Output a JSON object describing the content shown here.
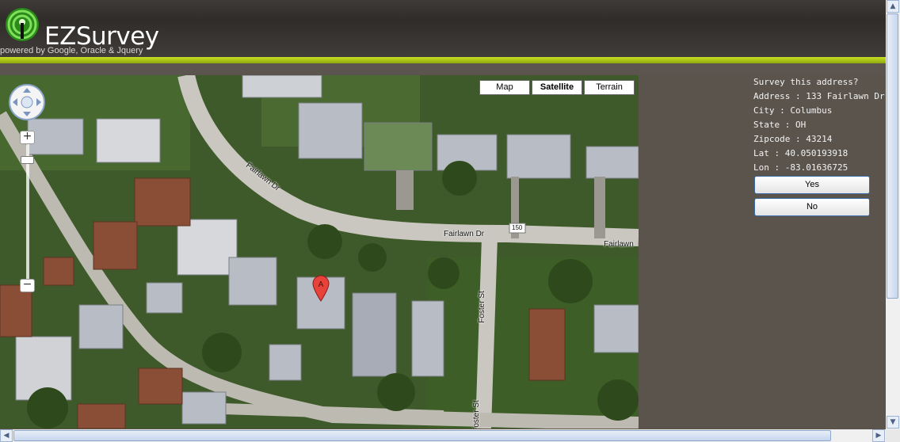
{
  "header": {
    "brand": "EZSurvey",
    "tagline": "powered by Google, Oracle & Jquery"
  },
  "map": {
    "type_buttons": [
      "Map",
      "Satellite",
      "Terrain"
    ],
    "active_type": "Satellite",
    "road_labels": {
      "fairlawn_1": "Fairlawn Dr",
      "fairlawn_2": "Fairlawn Dr",
      "fairlawn_3": "Fairlawn",
      "foster_1": "Foster St",
      "foster_2": "Foster St",
      "route_shield": "150"
    },
    "marker_label": "A",
    "zoom_in_symbol": "+",
    "zoom_out_symbol": "−"
  },
  "survey": {
    "question": "Survey this address?",
    "address": "Address : 133 Fairlawn Dr",
    "city": "City : Columbus",
    "state": "State : OH",
    "zipcode": "Zipcode : 43214",
    "lat": "Lat : 40.050193918",
    "lon": "Lon : -83.01636725",
    "yes_label": "Yes",
    "no_label": "No"
  },
  "colors": {
    "accent_green": "#b7d11c",
    "header_bg": "#3a3633",
    "panel_bg": "#5a544d",
    "button_border": "#3a6aa8"
  },
  "icons": {
    "logo": "signal-tower-icon",
    "pan": "pan-control-icon",
    "marker": "map-pin-icon"
  }
}
